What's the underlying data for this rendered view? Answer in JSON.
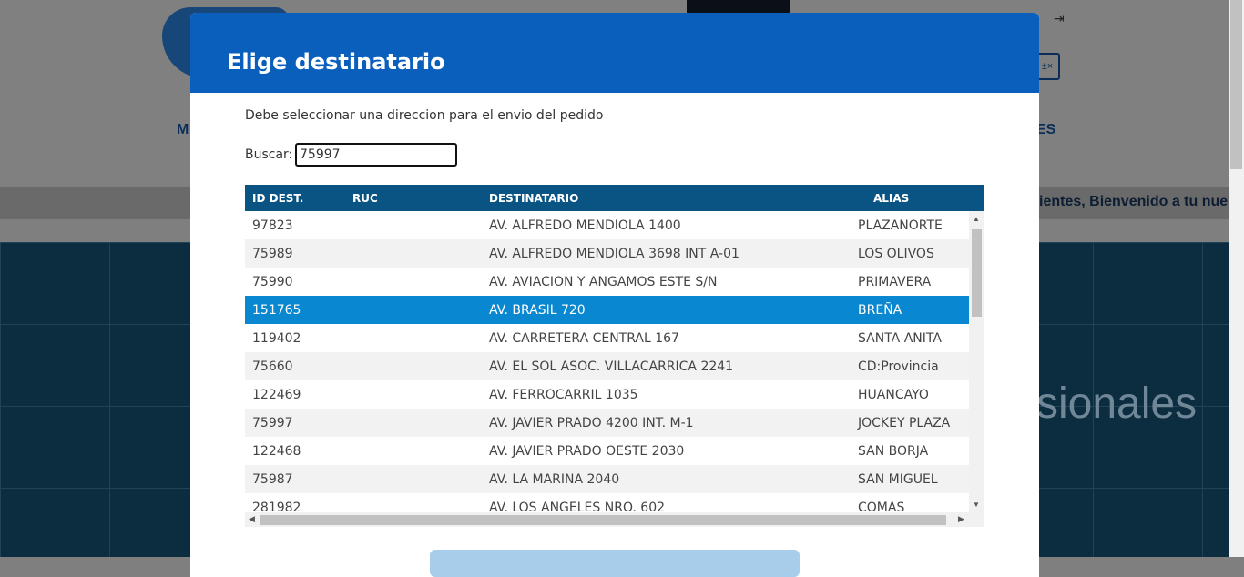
{
  "background": {
    "menu_left": "M",
    "menu_right": "ES",
    "marquee_text": "ientes, Bienvenido a tu nue",
    "hero_text": "sionales",
    "logout_icon": "logout-icon",
    "calculator_icon": "calculator-icon"
  },
  "modal": {
    "title": "Elige destinatario",
    "description": "Debe seleccionar una direccion para el envio del pedido",
    "search": {
      "label": "Buscar:",
      "value": "75997"
    },
    "columns": {
      "id": "ID DEST.",
      "ruc": "RUC",
      "dest": "DESTINATARIO",
      "alias": "ALIAS"
    },
    "rows": [
      {
        "id": "97823",
        "ruc": "",
        "dest": "AV. ALFREDO MENDIOLA 1400",
        "alias": "PLAZANORTE"
      },
      {
        "id": "75989",
        "ruc": "",
        "dest": "AV. ALFREDO MENDIOLA 3698 INT A-01",
        "alias": "LOS OLIVOS"
      },
      {
        "id": "75990",
        "ruc": "",
        "dest": "AV. AVIACION Y ANGAMOS ESTE S/N",
        "alias": "PRIMAVERA"
      },
      {
        "id": "151765",
        "ruc": "",
        "dest": "AV. BRASIL 720",
        "alias": "BREÑA"
      },
      {
        "id": "119402",
        "ruc": "",
        "dest": "AV. CARRETERA CENTRAL 167",
        "alias": "SANTA ANITA"
      },
      {
        "id": "75660",
        "ruc": "",
        "dest": "AV. EL SOL ASOC. VILLACARRICA 2241",
        "alias": "CD:Provincia"
      },
      {
        "id": "122469",
        "ruc": "",
        "dest": "AV. FERROCARRIL 1035",
        "alias": "HUANCAYO"
      },
      {
        "id": "75997",
        "ruc": "",
        "dest": "AV. JAVIER PRADO 4200 INT. M-1",
        "alias": "JOCKEY PLAZA"
      },
      {
        "id": "122468",
        "ruc": "",
        "dest": "AV. JAVIER PRADO OESTE 2030",
        "alias": "SAN BORJA"
      },
      {
        "id": "75987",
        "ruc": "",
        "dest": "AV. LA MARINA 2040",
        "alias": "SAN MIGUEL"
      },
      {
        "id": "281982",
        "ruc": "",
        "dest": "AV. LOS ANGELES NRO. 602",
        "alias": "COMAS"
      }
    ],
    "selected_row_id": "151765"
  }
}
